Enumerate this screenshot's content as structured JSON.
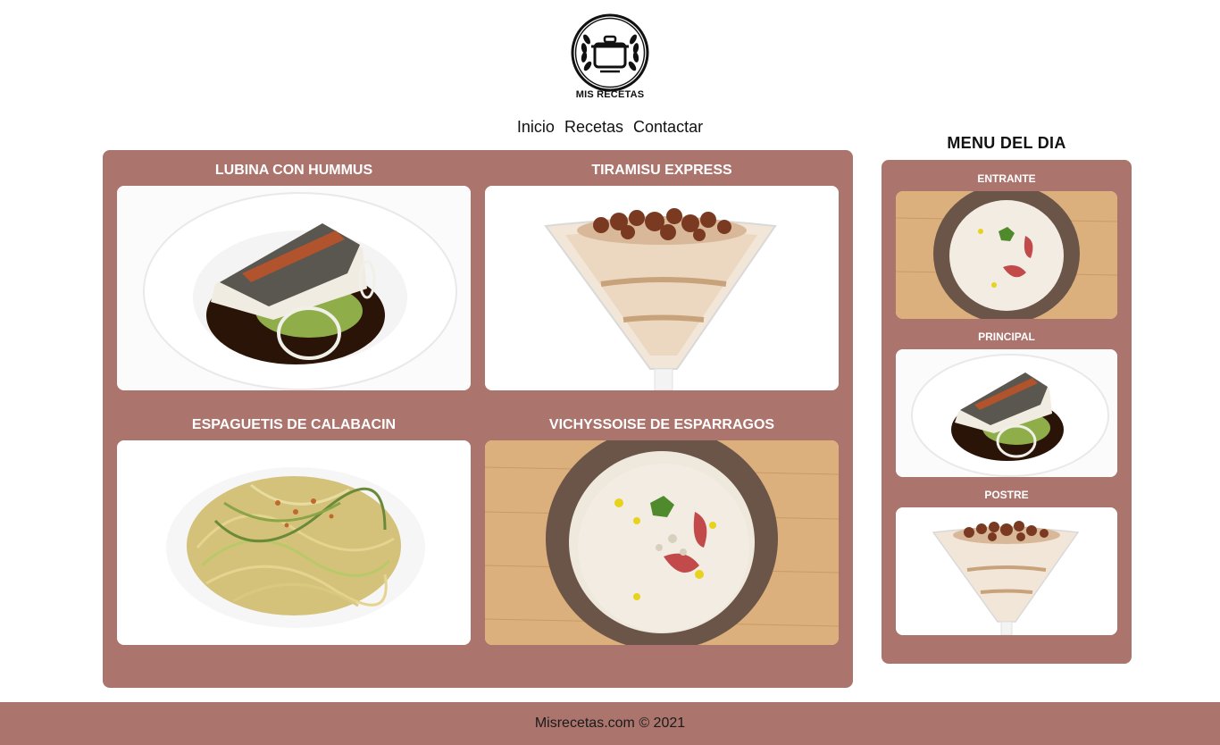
{
  "header": {
    "logo_text": "MIS RECETAS"
  },
  "nav": {
    "items": [
      "Inicio",
      "Recetas",
      "Contactar"
    ]
  },
  "recipes": [
    {
      "title": "LUBINA CON HUMMUS",
      "image": "sea-bass-plate"
    },
    {
      "title": "TIRAMISU EXPRESS",
      "image": "tiramisu-glass"
    },
    {
      "title": "ESPAGUETIS DE CALABACIN",
      "image": "zucchini-spaghetti"
    },
    {
      "title": "VICHYSSOISE DE ESPARRAGOS",
      "image": "asparagus-soup-bowl"
    }
  ],
  "menu_del_dia": {
    "title": "MENU DEL DIA",
    "items": [
      {
        "label": "ENTRANTE",
        "image": "asparagus-soup-bowl"
      },
      {
        "label": "PRINCIPAL",
        "image": "sea-bass-plate"
      },
      {
        "label": "POSTRE",
        "image": "tiramisu-glass"
      }
    ]
  },
  "footer": {
    "text": "Misrecetas.com © 2021"
  },
  "colors": {
    "panel": "#ab746d",
    "text": "#111111",
    "background": "#ffffff"
  }
}
